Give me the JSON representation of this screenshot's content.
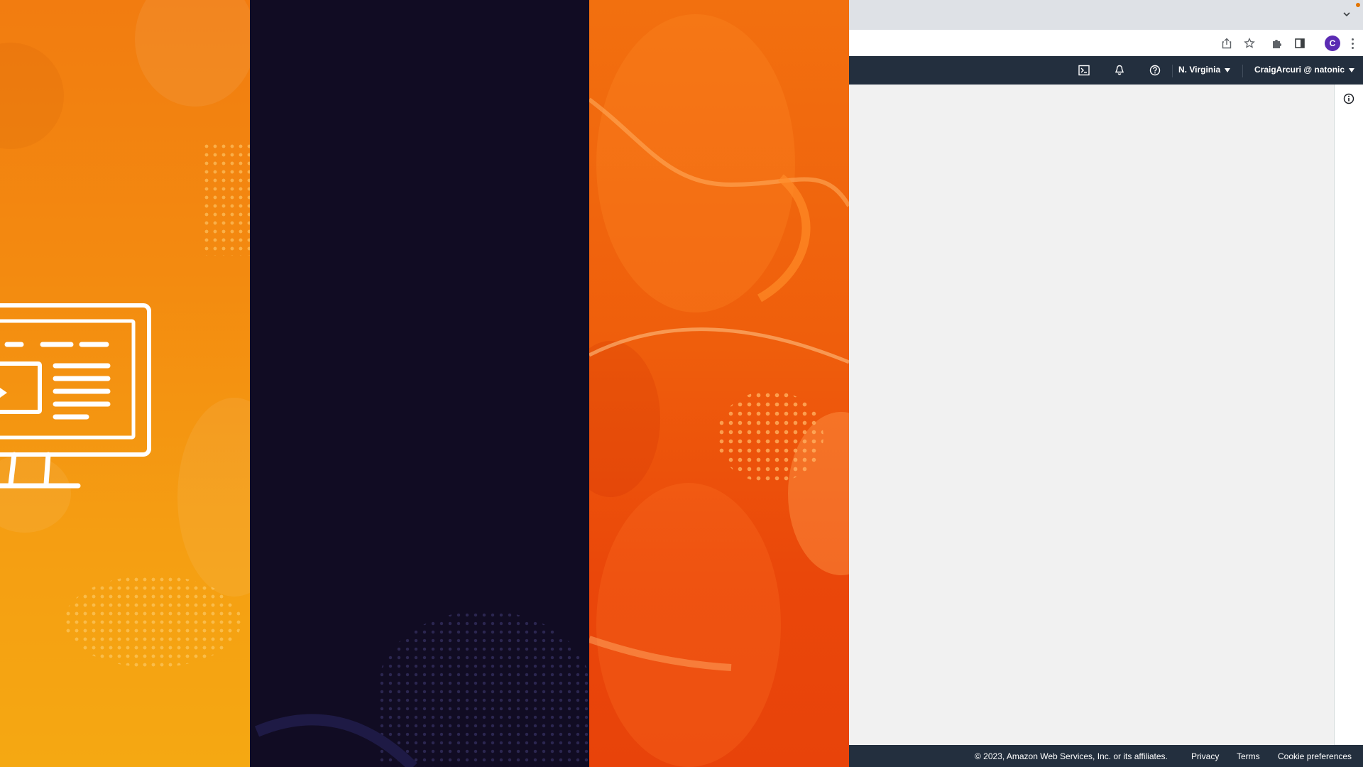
{
  "browser": {
    "toolbar_icons": [
      "share-icon",
      "star-icon",
      "puzzle-icon",
      "side-panel-icon"
    ],
    "profile_initial": "C",
    "tabstrip_icon": "chevron-down-icon"
  },
  "aws_nav": {
    "icons": [
      "cloudshell-icon",
      "bell-icon",
      "help-icon"
    ],
    "region": "N. Virginia",
    "account": "CraigArcuri @ natonic"
  },
  "side_rail": {
    "icon": "info-icon"
  },
  "footer": {
    "copyright": "© 2023, Amazon Web Services, Inc. or its affiliates.",
    "links": [
      "Privacy",
      "Terms",
      "Cookie preferences"
    ]
  },
  "colors": {
    "aws_nav_bg": "#232f3e",
    "panel_orange_left": "#f38a10",
    "panel_dark": "#110c23",
    "panel_orange_right": "#ea470a",
    "avatar": "#5b2bb3"
  }
}
